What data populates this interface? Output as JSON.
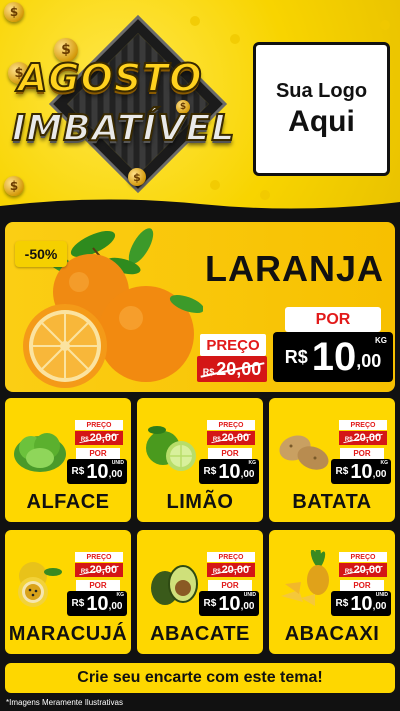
{
  "header": {
    "title_line1": "AGOSTO",
    "title_line2": "IMBATÍVEL",
    "logo_line1": "Sua Logo",
    "logo_line2": "Aqui",
    "coin_symbol": "$"
  },
  "featured": {
    "discount": "-50%",
    "name": "LARANJA",
    "preco_label": "PREÇO",
    "old_currency": "R$",
    "old_price": "20,00",
    "por_label": "POR",
    "currency": "R$",
    "price_int": "10",
    "price_dec": ",00",
    "unit": "KG"
  },
  "products": [
    {
      "name": "ALFACE",
      "preco_label": "PREÇO",
      "old_currency": "R$",
      "old_price": "20,00",
      "por_label": "POR",
      "currency": "R$",
      "price_int": "10",
      "price_dec": ",00",
      "unit": "UNID"
    },
    {
      "name": "LIMÃO",
      "preco_label": "PREÇO",
      "old_currency": "R$",
      "old_price": "20,00",
      "por_label": "POR",
      "currency": "R$",
      "price_int": "10",
      "price_dec": ",00",
      "unit": "KG"
    },
    {
      "name": "BATATA",
      "preco_label": "PREÇO",
      "old_currency": "R$",
      "old_price": "20,00",
      "por_label": "POR",
      "currency": "R$",
      "price_int": "10",
      "price_dec": ",00",
      "unit": "KG"
    },
    {
      "name": "MARACUJÁ",
      "preco_label": "PREÇO",
      "old_currency": "R$",
      "old_price": "20,00",
      "por_label": "POR",
      "currency": "R$",
      "price_int": "10",
      "price_dec": ",00",
      "unit": "KG"
    },
    {
      "name": "ABACATE",
      "preco_label": "PREÇO",
      "old_currency": "R$",
      "old_price": "20,00",
      "por_label": "POR",
      "currency": "R$",
      "price_int": "10",
      "price_dec": ",00",
      "unit": "UNID"
    },
    {
      "name": "ABACAXI",
      "preco_label": "PREÇO",
      "old_currency": "R$",
      "old_price": "20,00",
      "por_label": "POR",
      "currency": "R$",
      "price_int": "10",
      "price_dec": ",00",
      "unit": "UNID"
    }
  ],
  "cta": "Crie seu encarte com este tema!",
  "footnote": "*Imagens Meramente Ilustrativas",
  "colors": {
    "yellow": "#fed700",
    "red": "#d41616",
    "black": "#000000",
    "background": "#111111"
  },
  "product_icons": [
    "lettuce-icon",
    "lime-icon",
    "potato-icon",
    "passion-fruit-icon",
    "avocado-icon",
    "pineapple-icon"
  ]
}
